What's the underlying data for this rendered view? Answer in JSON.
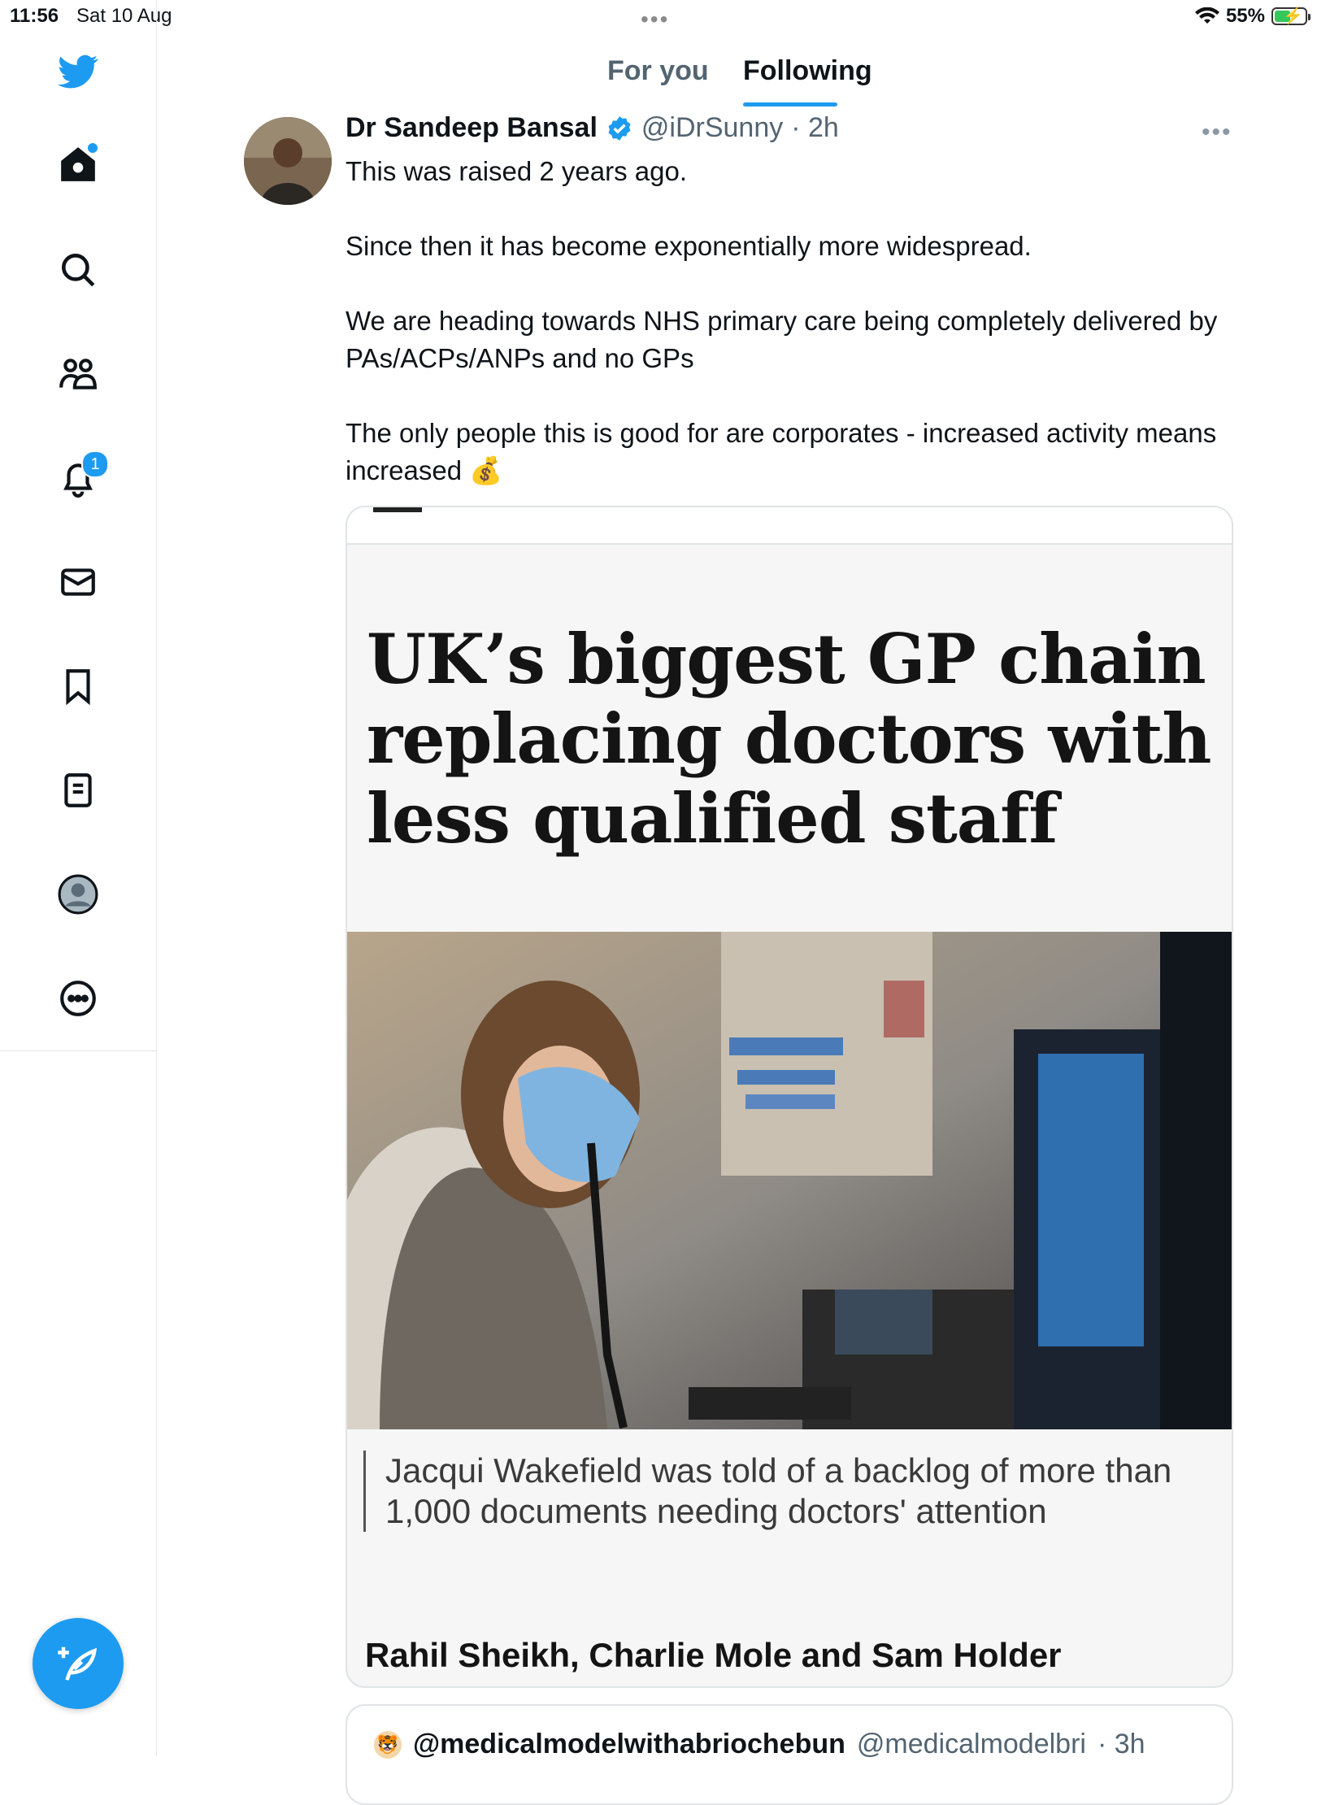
{
  "status_bar": {
    "time": "11:56",
    "date": "Sat 10 Aug",
    "battery": "55%",
    "battery_level": 0.55
  },
  "sidebar": {
    "items": [
      {
        "name": "twitter-logo",
        "icon": "bird-icon"
      },
      {
        "name": "home",
        "icon": "home-icon"
      },
      {
        "name": "explore",
        "icon": "search-icon"
      },
      {
        "name": "communities",
        "icon": "people-icon"
      },
      {
        "name": "notifications",
        "icon": "bell-icon",
        "badge": "1"
      },
      {
        "name": "messages",
        "icon": "mail-icon"
      },
      {
        "name": "bookmarks",
        "icon": "bookmark-icon"
      },
      {
        "name": "lists",
        "icon": "list-icon"
      },
      {
        "name": "profile",
        "icon": "avatar-icon"
      },
      {
        "name": "more",
        "icon": "more-circle-icon"
      }
    ],
    "compose_icon": "compose-icon"
  },
  "tabs": [
    {
      "label": "For you",
      "active": false
    },
    {
      "label": "Following",
      "active": true
    }
  ],
  "tweet": {
    "name": "Dr Sandeep Bansal",
    "handle": "@iDrSunny",
    "time": "· 2h",
    "paragraphs": [
      "This was raised 2 years ago.",
      "Since then it has become exponentially more widespread.",
      "We are heading towards NHS primary care being completely delivered by PAs/ACPs/ANPs and no GPs",
      "The only people this is good for are corporates - increased activity means increased 💰"
    ],
    "card": {
      "headline": "UK’s biggest GP chain replacing doctors with less qualified staff",
      "caption": "Jacqui Wakefield was told of a backlog of more than 1,000 documents needing doctors' attention",
      "byline": "Rahil Sheikh, Charlie Mole and Sam Holder"
    }
  },
  "next_tweet": {
    "avatar_emoji": "🐯",
    "name": "@medicalmodelwithabriochebun",
    "handle": "@medicalmodelbri",
    "time": "· 3h"
  },
  "colors": {
    "accent": "#1d9bf0",
    "text": "#0f1419",
    "secondary": "#536471"
  }
}
